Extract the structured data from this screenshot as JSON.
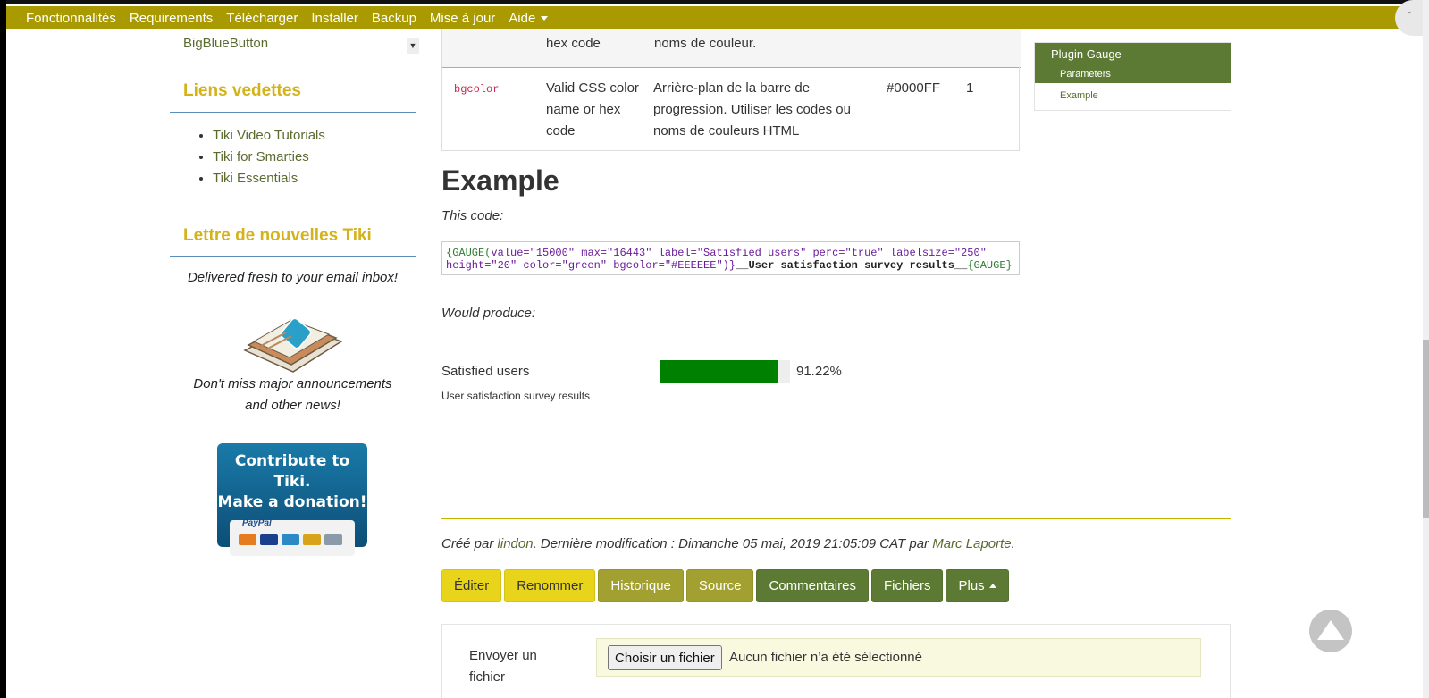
{
  "nav": {
    "items": [
      "Fonctionnalités",
      "Requirements",
      "Télécharger",
      "Installer",
      "Backup",
      "Mise à jour",
      "Aide"
    ]
  },
  "sidebar": {
    "bbb_item": "BigBlueButton",
    "featured_heading": "Liens vedettes",
    "featured_links": [
      "Tiki Video Tutorials",
      "Tiki for Smarties",
      "Tiki Essentials"
    ],
    "newsletter_heading": "Lettre de nouvelles Tiki",
    "newsletter_intro": "Delivered fresh to your email inbox!",
    "newsletter_outro": "Don't miss major announcements and other news!",
    "donate_line1": "Contribute to Tiki.",
    "donate_line2": "Make a donation!",
    "donate_brand": "PayPal"
  },
  "table": {
    "partial_row": {
      "type": "hex code",
      "description": "noms de couleur."
    },
    "bgcolor_row": {
      "name": "bgcolor",
      "type": "Valid CSS color name or hex code",
      "description": "Arrière-plan de la barre de progression. Utiliser les codes ou noms de couleurs HTML",
      "default": "#0000FF",
      "since": "1"
    }
  },
  "example": {
    "heading": "Example",
    "this_code": "This code:",
    "code_line1_kw": "{GAUGE(",
    "code_line1": "value=\"15000\" max=\"16443\" label=\"Satisfied users\" perc=\"true\" labelsize=\"250\"",
    "code_line2": "height=\"20\" color=\"green\" bgcolor=\"#EEEEEE\")}",
    "code_line2_bold": "__User satisfaction survey results__",
    "code_line2_end": "{GAUGE}",
    "would_produce": "Would produce:",
    "gauge_label": "Satisfied users",
    "gauge_percent": "91.22%",
    "gauge_value": 15000,
    "gauge_max": 16443,
    "gauge_color": "#008000",
    "gauge_bgcolor": "#EEEEEE",
    "gauge_caption": "User satisfaction survey results"
  },
  "meta": {
    "created_by_prefix": "Créé par",
    "created_by": "lindon",
    "modified_text": ". Dernière modification : Dimanche 05 mai, 2019 21:05:09 CAT par",
    "modified_by": "Marc Laporte",
    "end": "."
  },
  "actions": {
    "edit": "Éditer",
    "rename": "Renommer",
    "history": "Historique",
    "source": "Source",
    "comments": "Commentaires",
    "files": "Fichiers",
    "more": "Plus"
  },
  "upload": {
    "label": "Envoyer un fichier",
    "button": "Choisir un fichier",
    "none": "Aucun fichier n’a été sélectionné"
  },
  "toc": {
    "title": "Plugin Gauge",
    "parameters": "Parameters",
    "example": "Example"
  }
}
